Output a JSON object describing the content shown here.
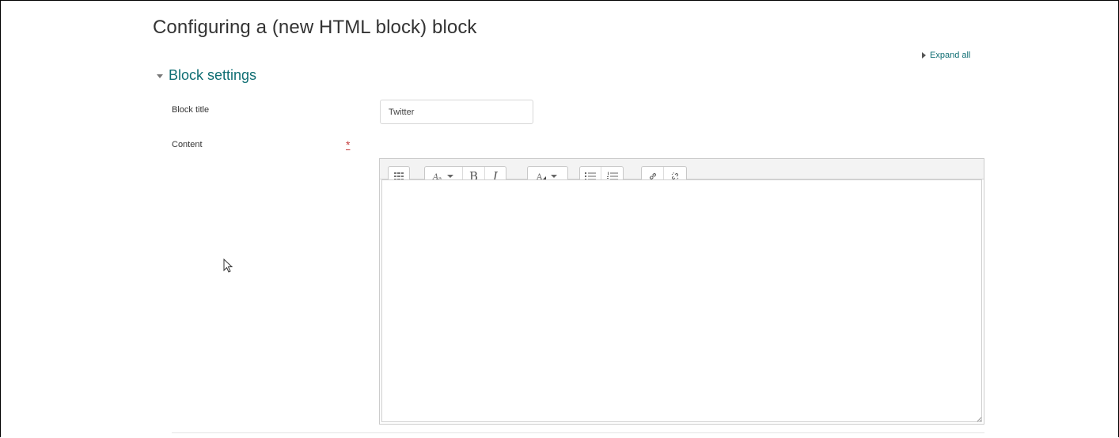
{
  "page": {
    "title": "Configuring a (new HTML block) block"
  },
  "actions": {
    "expand_all": "Expand all"
  },
  "section": {
    "title": "Block settings"
  },
  "fields": {
    "block_title": {
      "label": "Block title",
      "value": "Twitter"
    },
    "content": {
      "label": "Content",
      "required": true,
      "required_icon": "asterisk-icon",
      "value": ""
    }
  },
  "editor_toolbar": {
    "groups": [
      [
        "toolbar-toggle-icon"
      ],
      [
        "paragraph-style-icon",
        "bold-icon",
        "italic-icon"
      ],
      [
        "text-color-icon"
      ],
      [
        "unordered-list-icon",
        "ordered-list-icon"
      ],
      [
        "link-icon",
        "unlink-icon"
      ]
    ],
    "bold_glyph": "B",
    "italic_glyph": "I"
  },
  "colors": {
    "accent": "#0f6e73",
    "required": "#c43b3b",
    "toolbar_bg": "#f3f3f3"
  }
}
